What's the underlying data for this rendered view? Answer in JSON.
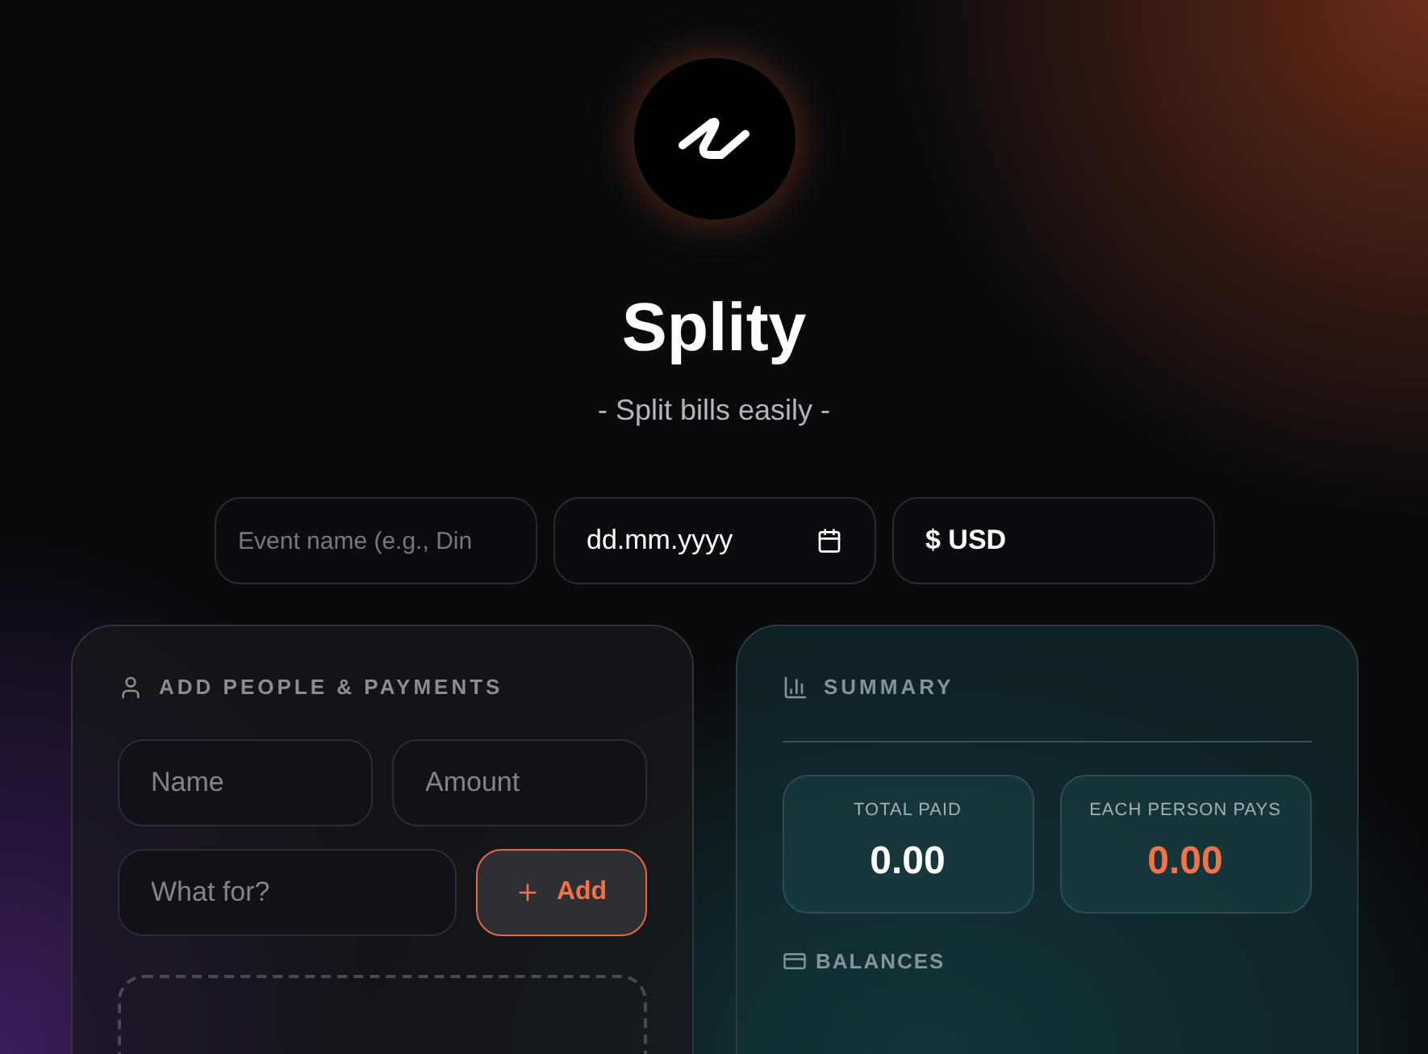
{
  "app": {
    "title": "Splity",
    "tagline": "- Split bills easily -"
  },
  "event_fields": [
    {
      "kind": "text",
      "placeholder": "Event name (e.g., Din"
    },
    {
      "kind": "date",
      "value": "dd.mm.yyyy"
    },
    {
      "kind": "select",
      "value": "$ USD"
    }
  ],
  "people_panel": {
    "title": "ADD PEOPLE & PAYMENTS",
    "fields": [
      {
        "placeholder": "Name"
      },
      {
        "placeholder": "Amount"
      },
      {
        "placeholder": "What for?"
      }
    ],
    "add_button": {
      "label": "Add"
    }
  },
  "summary_panel": {
    "title": "SUMMARY",
    "stats": [
      {
        "label": "TOTAL PAID",
        "value": "0.00",
        "highlight": false
      },
      {
        "label": "EACH PERSON PAYS",
        "value": "0.00",
        "highlight": true
      }
    ],
    "balances_title": "BALANCES"
  }
}
